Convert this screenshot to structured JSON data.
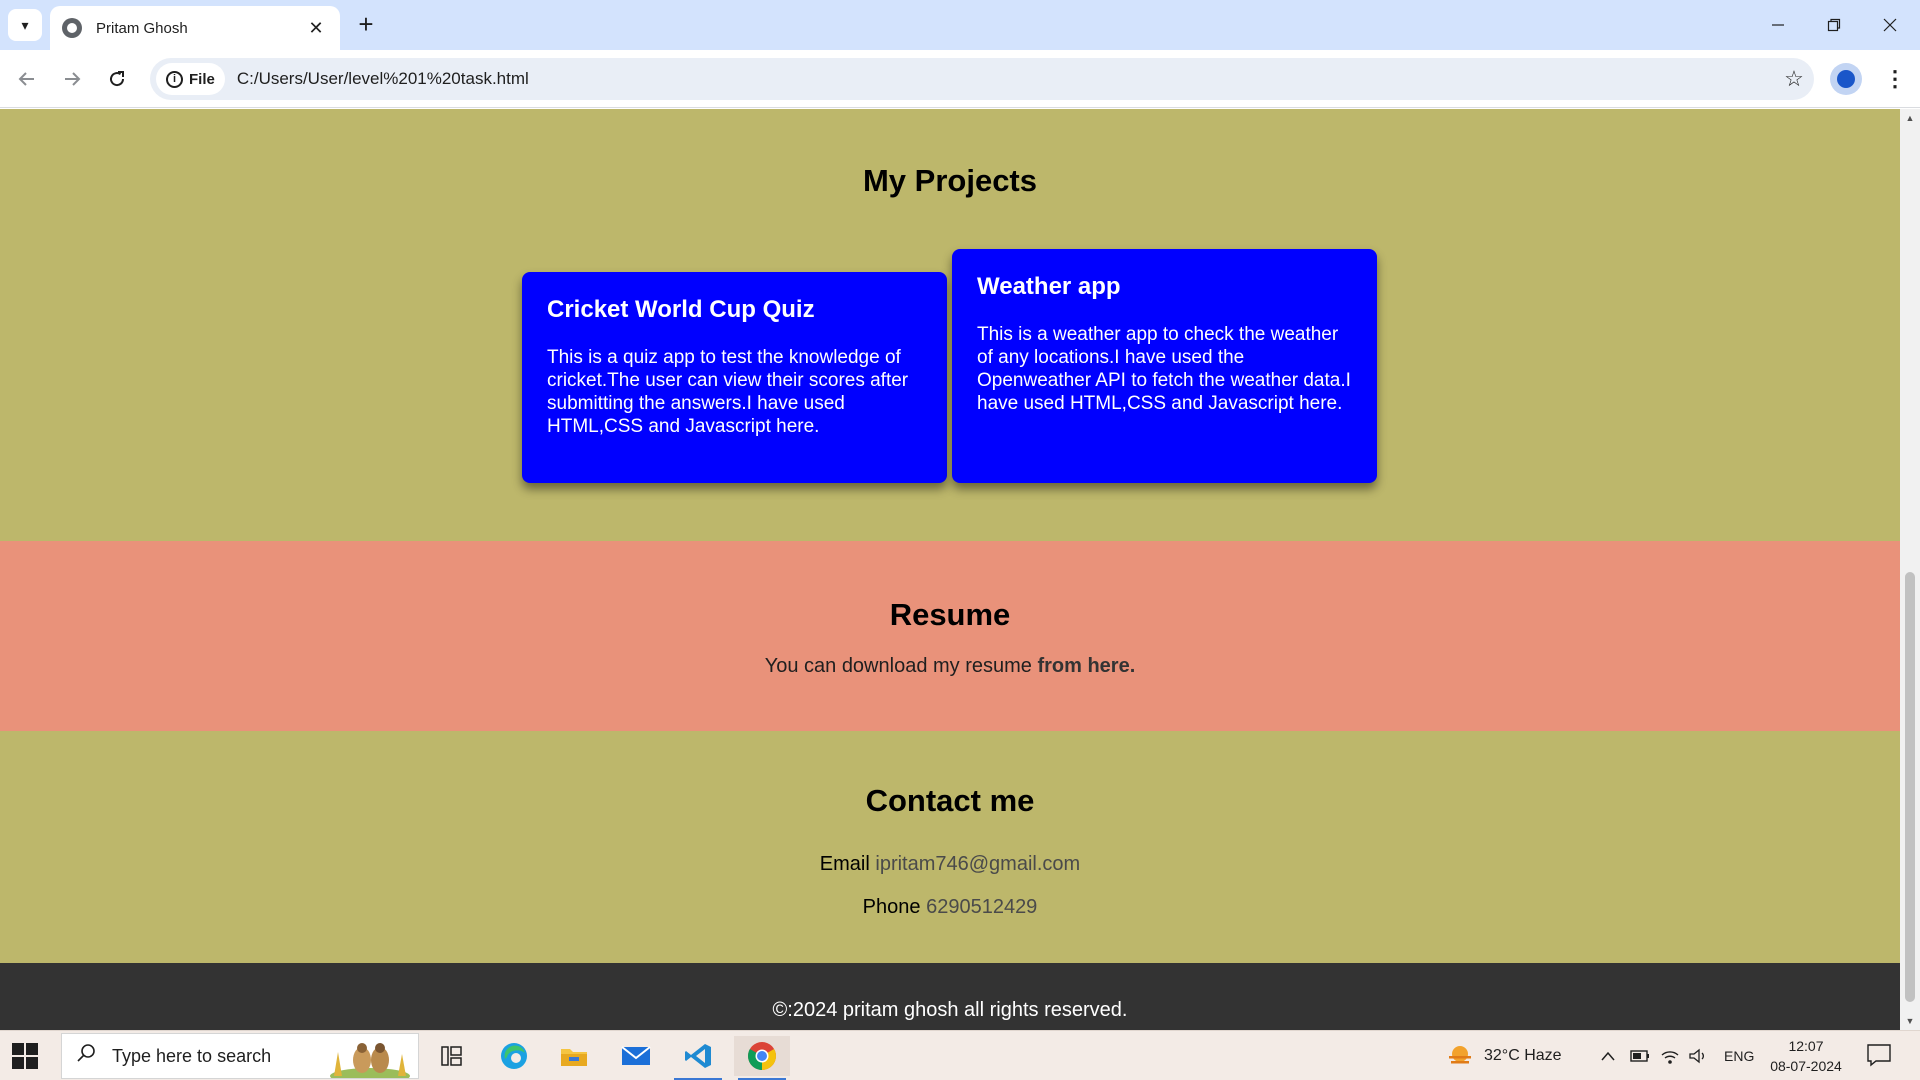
{
  "browser": {
    "tab_title": "Pritam Ghosh",
    "tab_close": "✕",
    "new_tab": "+",
    "site_chip_label": "File",
    "url": "C:/Users/User/level%201%20task.html",
    "icons": [
      "tab-search-icon",
      "globe-favicon-icon",
      "back-icon",
      "forward-icon",
      "reload-icon",
      "info-icon",
      "bookmark-star-icon",
      "profile-icon",
      "menu-icon",
      "minimize-icon",
      "restore-icon",
      "close-icon"
    ]
  },
  "page": {
    "projects": {
      "title": "My Projects",
      "cards": [
        {
          "title": "Cricket World Cup Quiz",
          "text": "This is a quiz app to test the knowledge of cricket.The user can view their scores after submitting the answers.I have used HTML,CSS and Javascript here."
        },
        {
          "title": "Weather app",
          "text": "This is a weather app to check the weather of any locations.I have used the Openweather API to fetch the weather data.I have used HTML,CSS and Javascript here."
        }
      ]
    },
    "resume": {
      "title": "Resume",
      "text": "You can download my resume ",
      "link": "from here."
    },
    "contact": {
      "title": "Contact me",
      "email_label": "Email",
      "email": "ipritam746@gmail.com",
      "phone_label": "Phone",
      "phone": "6290512429"
    },
    "footer": "©:2024 pritam ghosh all rights reserved."
  },
  "taskbar": {
    "search_placeholder": "Type here to search",
    "weather": "32°C  Haze",
    "language": "ENG",
    "time": "12:07",
    "date": "08-07-2024",
    "apps": [
      "task-view-icon",
      "edge-icon",
      "file-explorer-icon",
      "mail-icon",
      "vscode-icon",
      "chrome-icon"
    ]
  },
  "colors": {
    "projects_bg": "#bdb76b",
    "resume_bg": "#e9927a",
    "card_bg": "#0000ff",
    "footer_bg": "#333333"
  }
}
